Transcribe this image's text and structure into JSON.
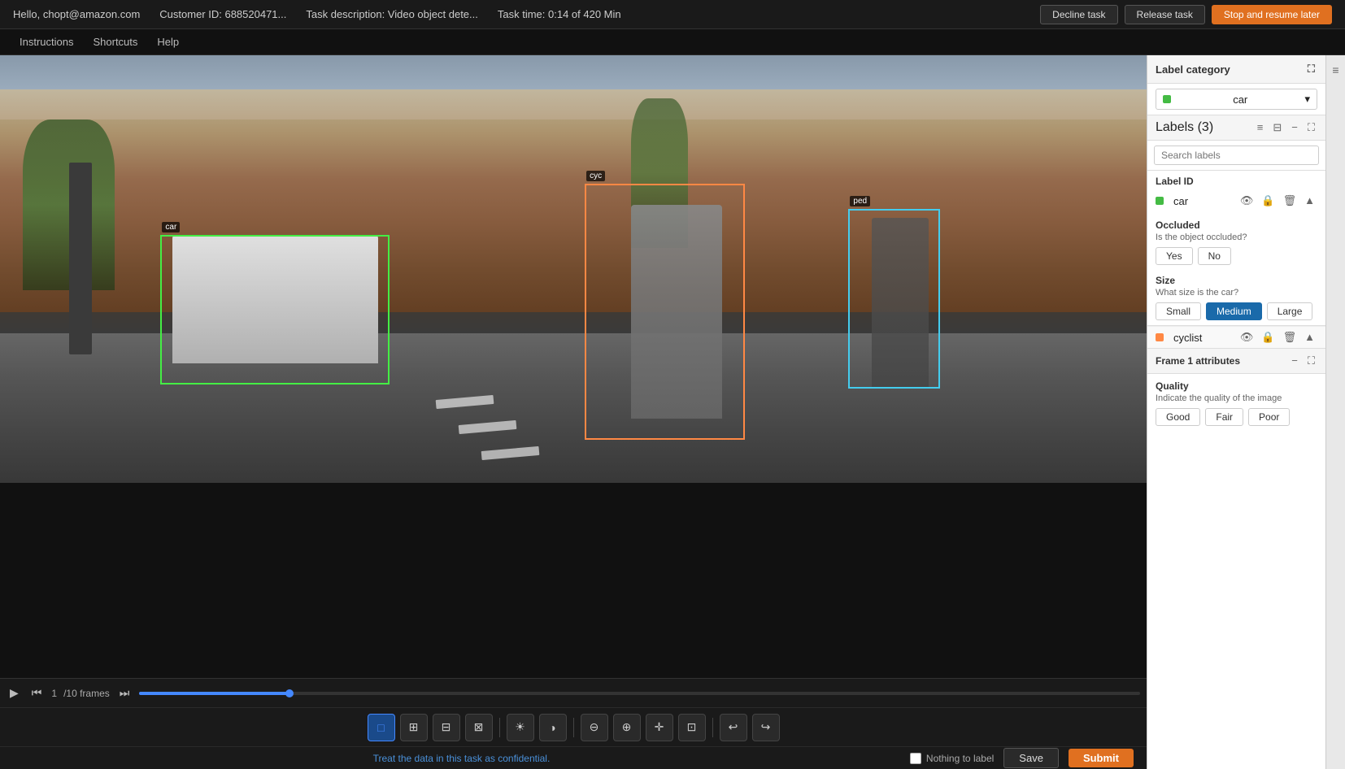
{
  "topbar": {
    "greeting": "Hello, chopt@amazon.com",
    "customer_id": "Customer ID: 688520471...",
    "task_description": "Task description: Video object dete...",
    "task_time": "Task time: 0:14 of 420 Min",
    "decline_label": "Decline task",
    "release_label": "Release task",
    "stop_label": "Stop and resume later"
  },
  "subnav": {
    "instructions": "Instructions",
    "shortcuts": "Shortcuts",
    "help": "Help"
  },
  "right_panel": {
    "label_category_title": "Label category",
    "selected_category": "car",
    "labels_title": "Labels",
    "labels_count": "Labels (3)",
    "search_placeholder": "Search labels",
    "label_id_title": "Label ID",
    "label_id_value": "car",
    "occluded_title": "Occluded",
    "occluded_sub": "Is the object occluded?",
    "occluded_yes": "Yes",
    "occluded_no": "No",
    "size_title": "Size",
    "size_sub": "What size is the car?",
    "size_small": "Small",
    "size_medium": "Medium",
    "size_large": "Large",
    "size_selected": "Medium",
    "cyclist_label": "cyclist",
    "frame_attr_title": "Frame 1 attributes",
    "quality_title": "Quality",
    "quality_sub": "Indicate the quality of the image",
    "quality_good": "Good",
    "quality_fair": "Fair",
    "quality_poor": "Poor"
  },
  "toolbar": {
    "tools": [
      "□",
      "⊞",
      "⊟",
      "⊠"
    ],
    "adjustments": [
      "☀",
      "◑",
      "⊖",
      "⊕",
      "✛",
      "⊡"
    ],
    "undo": "↩",
    "redo": "↪"
  },
  "timeline": {
    "play_icon": "▶",
    "prev_icon": "⏮",
    "frame_current": "1",
    "frame_total": "/10 frames",
    "next_icon": "⏭"
  },
  "footer": {
    "confidential_text": "Treat the data in this task as confidential.",
    "nothing_label": "Nothing to label",
    "save_label": "Save",
    "submit_label": "Submit"
  },
  "annotations": {
    "car_label": "car",
    "cyc_label": "cyc",
    "ped_label": "ped"
  }
}
